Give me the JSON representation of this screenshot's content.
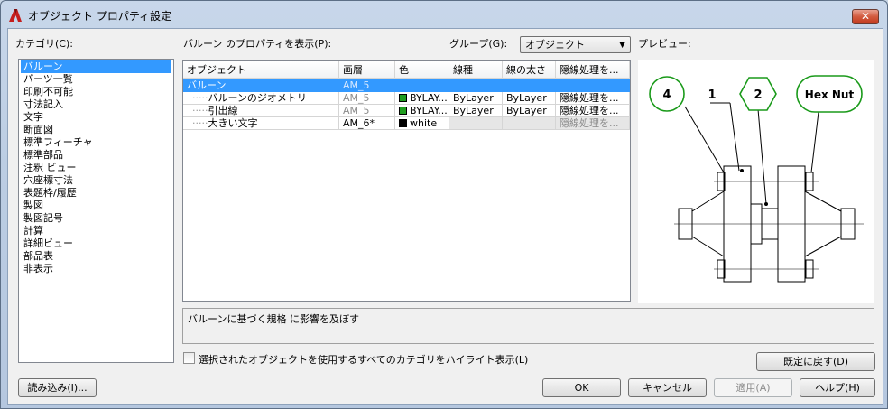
{
  "window": {
    "title": "オブジェクト プロパティ設定",
    "close_glyph": "✕"
  },
  "category": {
    "label": "カテゴリ(C):",
    "items": [
      "バルーン",
      "パーツ一覧",
      "印刷不可能",
      "寸法記入",
      "文字",
      "断面図",
      "標準フィーチャ",
      "標準部品",
      "注釈 ビュー",
      "穴座標寸法",
      "表題枠/履歴",
      "製図",
      "製図記号",
      "計算",
      "詳細ビュー",
      "部品表",
      "非表示"
    ],
    "selected_index": 0
  },
  "properties": {
    "label": "バルーン のプロパティを表示(P):",
    "columns": [
      "オブジェクト",
      "画層",
      "色",
      "線種",
      "線の太さ",
      "隠線処理を..."
    ],
    "rows": [
      {
        "object": "バルーン",
        "layer": "AM_5",
        "color": "",
        "color_hex": "",
        "linetype": "",
        "lineweight": "",
        "hidden": "",
        "selected": true,
        "greyed": false
      },
      {
        "object": "バルーンのジオメトリ",
        "layer": "AM_5",
        "color": "BYLAY...",
        "color_hex": "#1f9d1f",
        "linetype": "ByLayer",
        "lineweight": "ByLayer",
        "hidden": "隠線処理を...",
        "selected": false,
        "greyed": false
      },
      {
        "object": "引出線",
        "layer": "AM_5",
        "color": "BYLAY...",
        "color_hex": "#1f9d1f",
        "linetype": "ByLayer",
        "lineweight": "ByLayer",
        "hidden": "隠線処理を...",
        "selected": false,
        "greyed": false
      },
      {
        "object": "大きい文字",
        "layer": "AM_6*",
        "color": "white",
        "color_hex": "#000000",
        "linetype": "",
        "lineweight": "",
        "hidden": "隠線処理を...",
        "selected": false,
        "greyed": true
      }
    ]
  },
  "group": {
    "label": "グループ(G):",
    "value": "オブジェクト"
  },
  "preview": {
    "label": "プレビュー:",
    "balloons": [
      "4",
      "1",
      "2",
      "Hex Nut"
    ]
  },
  "description": "バルーンに基づく規格 に影響を及ぼす",
  "highlight_checkbox": {
    "label": "選択されたオブジェクトを使用するすべてのカテゴリをハイライト表示(L)",
    "checked": false
  },
  "buttons": {
    "reset": "既定に戻す(D)",
    "load": "読み込み(I)...",
    "ok": "OK",
    "cancel": "キャンセル",
    "apply": "適用(A)",
    "help": "ヘルプ(H)"
  },
  "colors": {
    "selection": "#3399ff",
    "balloon_green": "#1a9a1a"
  }
}
